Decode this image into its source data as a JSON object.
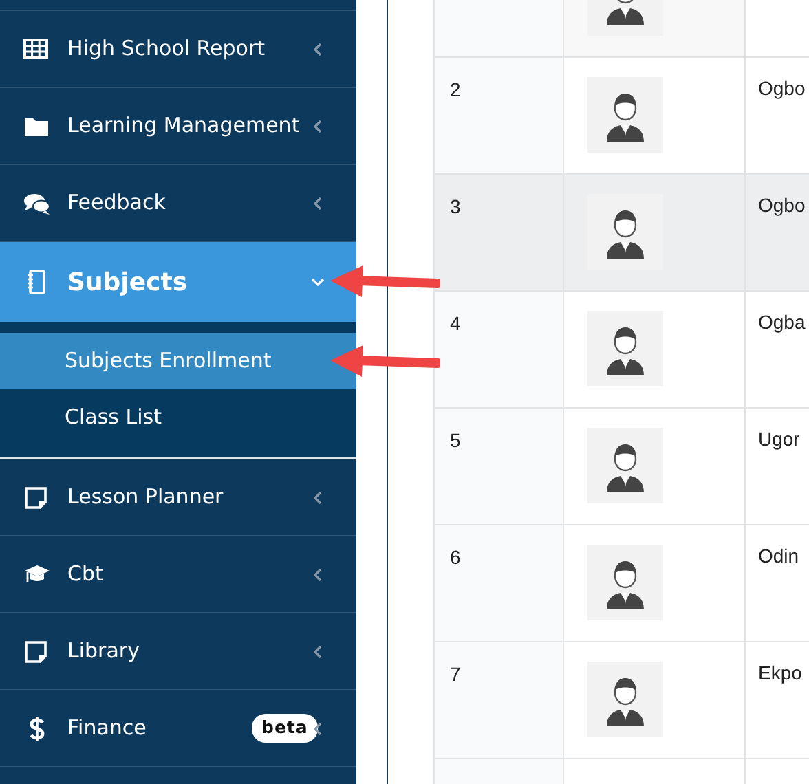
{
  "sidebar": {
    "items": [
      {
        "label": "High School Report",
        "selected": false,
        "expanded": false
      },
      {
        "label": "Learning Management",
        "selected": false,
        "expanded": false
      },
      {
        "label": "Feedback",
        "selected": false,
        "expanded": false
      },
      {
        "label": "Subjects",
        "selected": true,
        "expanded": true,
        "arrow": true,
        "children": [
          {
            "label": "Subjects Enrollment",
            "selected": true,
            "arrow": true
          },
          {
            "label": "Class List",
            "selected": false
          }
        ]
      },
      {
        "label": "Lesson Planner",
        "selected": false,
        "expanded": false
      },
      {
        "label": "Cbt",
        "selected": false,
        "expanded": false
      },
      {
        "label": "Library",
        "selected": false,
        "expanded": false
      },
      {
        "label": "Finance",
        "selected": false,
        "expanded": false,
        "badge": "beta"
      }
    ]
  },
  "table": {
    "rows": [
      {
        "highlighted": false
      },
      {
        "number": "2",
        "name": "Ogbo",
        "highlighted": false
      },
      {
        "number": "3",
        "name": "Ogbo",
        "highlighted": true
      },
      {
        "number": "4",
        "name": "Ogba",
        "highlighted": false
      },
      {
        "number": "5",
        "name": "Ugor",
        "highlighted": false
      },
      {
        "number": "6",
        "name": "Odin",
        "highlighted": false
      },
      {
        "number": "7",
        "name": "Ekpo",
        "highlighted": false
      }
    ]
  }
}
